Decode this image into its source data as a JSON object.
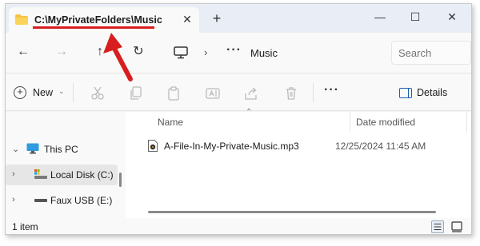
{
  "window": {
    "tab_title": "C:\\MyPrivateFolders\\Music",
    "tab_close": "✕",
    "new_tab": "+",
    "controls": {
      "minimize": "—",
      "maximize": "☐",
      "close": "✕"
    }
  },
  "nav": {
    "back": "←",
    "forward": "→",
    "up": "↑",
    "refresh": "↻",
    "breadcrumb_sep": "›",
    "breadcrumb_overflow": "···",
    "breadcrumb_current": "Music",
    "search_placeholder": "Search"
  },
  "commandbar": {
    "new_label": "New",
    "new_caret": "⌄",
    "more": "···",
    "details_label": "Details"
  },
  "sidebar": {
    "items": [
      {
        "label": "This PC",
        "chevron": "⌄",
        "icon": "monitor-icon"
      },
      {
        "label": "Local Disk (C:)",
        "chevron": "›",
        "icon": "drive-icon"
      },
      {
        "label": "Faux USB (E:)",
        "chevron": "›",
        "icon": "usb-drive-icon"
      }
    ]
  },
  "content": {
    "sort_caret": "⌃",
    "columns": {
      "name": "Name",
      "date_modified": "Date modified"
    },
    "files": [
      {
        "name": "A-File-In-My-Private-Music.mp3",
        "date_modified": "12/25/2024 11:45 AM",
        "icon": "audio-file-icon"
      }
    ]
  },
  "status": {
    "item_count": "1 item"
  },
  "annotation": {
    "color": "#d81e1e"
  }
}
